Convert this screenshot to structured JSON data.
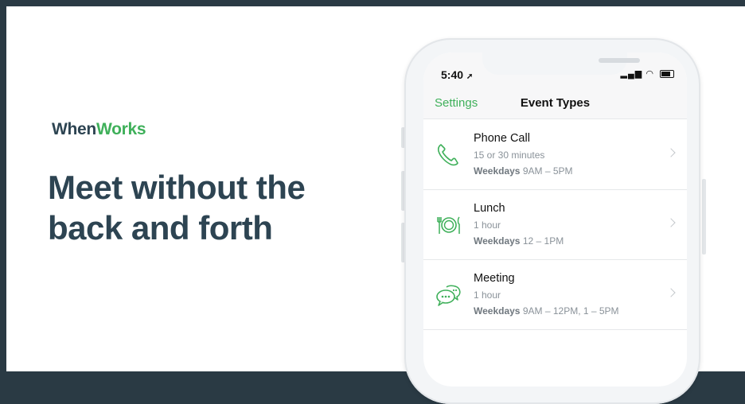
{
  "brand": {
    "part1": "When",
    "part2": "Works"
  },
  "headline": {
    "line1": "Meet without the",
    "line2": "back and forth"
  },
  "status_bar": {
    "time": "5:40"
  },
  "nav": {
    "back_label": "Settings",
    "title": "Event Types"
  },
  "events": [
    {
      "title": "Phone Call",
      "duration": "15 or 30 minutes",
      "days": "Weekdays",
      "hours": "9AM – 5PM",
      "icon": "phone-icon"
    },
    {
      "title": "Lunch",
      "duration": "1 hour",
      "days": "Weekdays",
      "hours": "12 – 1PM",
      "icon": "plate-cutlery-icon"
    },
    {
      "title": "Meeting",
      "duration": "1 hour",
      "days": "Weekdays",
      "hours": "9AM – 12PM, 1 – 5PM",
      "icon": "chat-bubbles-icon"
    }
  ],
  "colors": {
    "accent": "#3fb05a",
    "text_dark": "#2d4452",
    "frame": "#2a3a44"
  }
}
